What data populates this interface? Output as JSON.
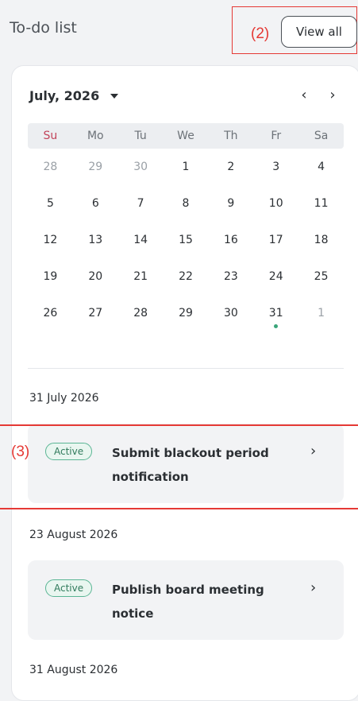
{
  "header": {
    "title": "To-do list",
    "view_all": "View all"
  },
  "annotations": {
    "a2": "(2)",
    "a3": "(3)"
  },
  "calendar": {
    "month_label": "July, 2026",
    "prev_icon": "chevron-left",
    "next_icon": "chevron-right",
    "weekdays": [
      "Su",
      "Mo",
      "Tu",
      "We",
      "Th",
      "Fr",
      "Sa"
    ],
    "weeks": [
      [
        "28",
        "29",
        "30",
        "1",
        "2",
        "3",
        "4"
      ],
      [
        "5",
        "6",
        "7",
        "8",
        "9",
        "10",
        "11"
      ],
      [
        "12",
        "13",
        "14",
        "15",
        "16",
        "17",
        "18"
      ],
      [
        "19",
        "20",
        "21",
        "22",
        "23",
        "24",
        "25"
      ],
      [
        "26",
        "27",
        "28",
        "29",
        "30",
        "31",
        "1"
      ]
    ],
    "muted_days": [
      [
        0,
        0
      ],
      [
        0,
        1
      ],
      [
        0,
        2
      ],
      [
        4,
        6
      ]
    ],
    "event_day": [
      4,
      5
    ],
    "event_dot_color": "#3aa57a"
  },
  "tasks": [
    {
      "date": "31 July 2026",
      "status": "Active",
      "title": "Submit blackout period notification"
    },
    {
      "date": "23 August 2026",
      "status": "Active",
      "title": "Publish board meeting notice"
    },
    {
      "date": "31 August 2026"
    }
  ]
}
